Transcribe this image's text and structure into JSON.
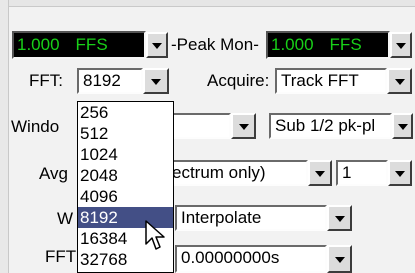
{
  "peak_monitor": {
    "left_value": "1.000",
    "left_unit": "FFS",
    "label": "-Peak Mon-",
    "right_value": "1.000",
    "right_unit": "FFS"
  },
  "fft": {
    "label": "FFT:",
    "selected": "8192",
    "options": [
      "256",
      "512",
      "1024",
      "2048",
      "4096",
      "8192",
      "16384",
      "32768"
    ],
    "highlighted": "8192"
  },
  "acquire": {
    "label": "Acquire:",
    "value": "Track FFT"
  },
  "window": {
    "label_visible": "Windo"
  },
  "scale": {
    "value": "Sub 1/2 pk-pl"
  },
  "avg": {
    "label_visible": "Avg",
    "mode_visible": "ectrum only)",
    "count": "1"
  },
  "w_field": {
    "label_visible": "W",
    "value": "Interpolate"
  },
  "fft_offset": {
    "label_visible": "FFT",
    "value": "0.00000000s"
  }
}
